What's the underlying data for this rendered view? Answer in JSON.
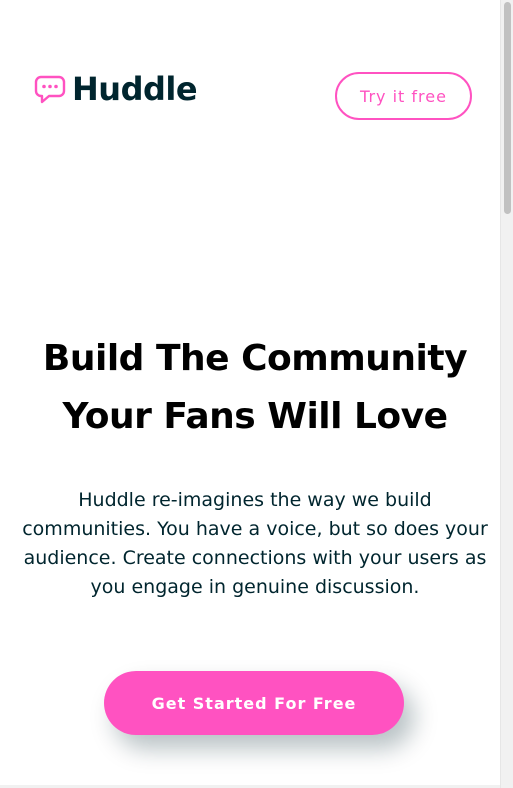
{
  "header": {
    "logo_text": "Huddle",
    "logo_icon": "chat-bubble-icon",
    "try_button_label": "Try it free"
  },
  "hero": {
    "title_line1": "Build The Community",
    "title_line2": "Your Fans Will Love",
    "description": "Huddle re-imagines the way we build communities. You have a voice, but so does your audience. Create connections with your users as you engage in genuine discussion.",
    "cta_label": "Get Started For Free"
  },
  "colors": {
    "accent": "#ff52c1",
    "text_dark": "#00252e",
    "background": "#ffffff"
  }
}
